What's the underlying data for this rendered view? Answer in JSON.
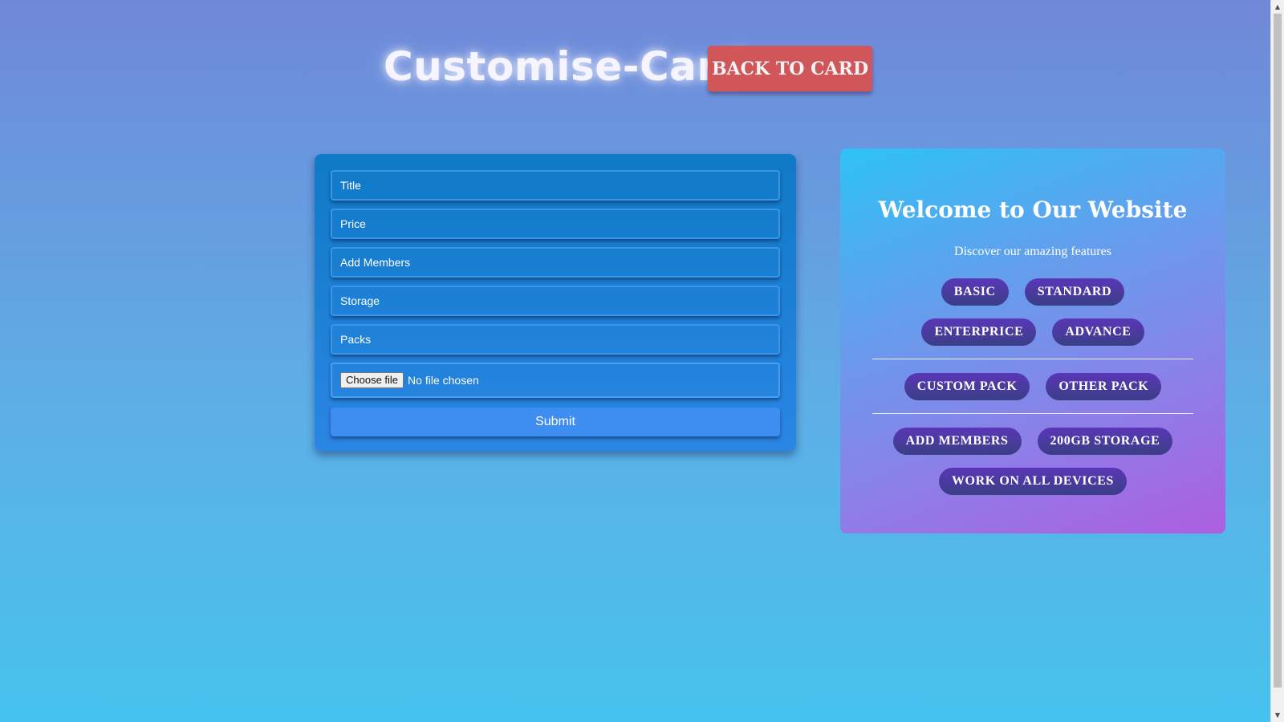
{
  "header": {
    "title": "Customise-Card",
    "back_button_label": "BACK TO CARD"
  },
  "form": {
    "title_placeholder": "Title",
    "price_placeholder": "Price",
    "members_placeholder": "Add Members",
    "storage_placeholder": "Storage",
    "packs_placeholder": "Packs",
    "choose_file_label": "Choose file",
    "file_status": "No file chosen",
    "submit_label": "Submit"
  },
  "preview": {
    "heading": "Welcome to Our Website",
    "subtitle": "Discover our amazing features",
    "plans": [
      "BASIC",
      "STANDARD",
      "ENTERPRICE",
      "ADVANCE"
    ],
    "packs": [
      "CUSTOM PACK",
      "OTHER PACK"
    ],
    "features": [
      "ADD MEMBERS",
      "200GB STORAGE",
      "WORK ON ALL DEVICES"
    ]
  },
  "colors": {
    "back_button": "#d0565a",
    "pill": "#4a3aa0",
    "form_card": "#1a7fd4",
    "preview_gradient_start": "#2ec2f5",
    "preview_gradient_end": "#ad5ee0"
  }
}
